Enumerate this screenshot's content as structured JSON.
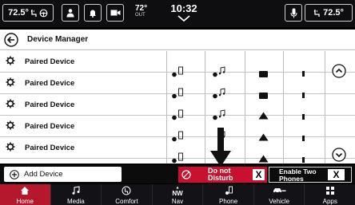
{
  "statusbar": {
    "temp_left": "72.5°",
    "out_temp": "72°",
    "out_label": "OUT",
    "clock": "10:32",
    "temp_right": "72.5°"
  },
  "header": {
    "title": "Device Manager"
  },
  "devices": [
    {
      "name": "Paired Device"
    },
    {
      "name": "Paired Device"
    },
    {
      "name": "Paired Device"
    },
    {
      "name": "Paired Device"
    },
    {
      "name": "Paired Device"
    }
  ],
  "actions": {
    "add_device": "Add Device",
    "dnd_line1": "Do not",
    "dnd_line2": "Disturb",
    "two_line1": "Enable Two",
    "two_line2": "Phones",
    "close_glyph": "X"
  },
  "nav": [
    {
      "label": "Home",
      "icon": "home-icon",
      "active": true
    },
    {
      "label": "Media",
      "icon": "music-note-icon"
    },
    {
      "label": "Comfort",
      "icon": "seat-icon"
    },
    {
      "label": "Nav",
      "icon": "compass-icon",
      "compass_text": "NW"
    },
    {
      "label": "Phone",
      "icon": "phone-icon"
    },
    {
      "label": "Vehicle",
      "icon": "car-icon"
    },
    {
      "label": "Apps",
      "icon": "apps-grid-icon"
    }
  ],
  "colors": {
    "accent": "#b5182c",
    "dnd": "#c9102e"
  }
}
